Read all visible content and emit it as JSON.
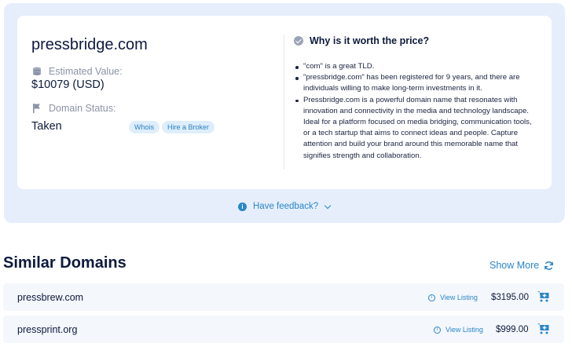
{
  "domain": {
    "name": "pressbridge.com",
    "estimated_value_label": "Estimated Value:",
    "estimated_value": "$10079 (USD)",
    "status_label": "Domain Status:",
    "status": "Taken",
    "whois_label": "Whois",
    "broker_label": "Hire a Broker"
  },
  "why": {
    "heading": "Why is it worth the price?",
    "items": [
      "\"com\" is a great TLD.",
      "\"pressbridge.com\" has been registered for 9 years, and there are individuals willing to make long-term investments in it.",
      "Pressbridge.com is a powerful domain name that resonates with innovation and connectivity in the media and technology landscape. Ideal for a platform focused on media bridging, communication tools, or a tech startup that aims to connect ideas and people. Capture attention and build your brand around this memorable name that signifies strength and collaboration."
    ]
  },
  "feedback": {
    "label": "Have feedback?"
  },
  "similar": {
    "title": "Similar Domains",
    "show_more": "Show More",
    "view_listing": "View Listing",
    "items": [
      {
        "name": "pressbrew.com",
        "price": "$3195.00"
      },
      {
        "name": "pressprint.org",
        "price": "$999.00"
      }
    ]
  },
  "colors": {
    "accent": "#2a86c8",
    "panel": "#e6eefc",
    "text": "#0e1a3d"
  }
}
